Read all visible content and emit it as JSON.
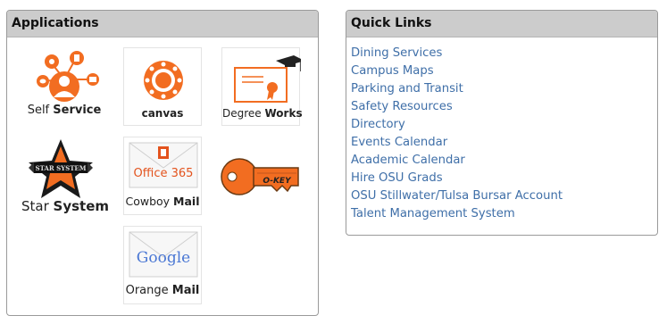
{
  "applications": {
    "title": "Applications",
    "tiles": {
      "self_service": {
        "label_a": "Self ",
        "label_b": "Service"
      },
      "canvas": {
        "label": "canvas"
      },
      "degree_works": {
        "label_a": "Degree ",
        "label_b": "Works"
      },
      "star_system": {
        "label_a": "Star ",
        "label_b": "System",
        "badge_text": "STAR SYSTEM"
      },
      "cowboy_mail": {
        "label_a": "Cowboy ",
        "label_b": "Mail",
        "logo_text": "Office 365"
      },
      "okey": {
        "label": "O-KEY"
      },
      "orange_mail": {
        "label_a": "Orange ",
        "label_b": "Mail",
        "logo_text": "Google"
      }
    }
  },
  "quick_links": {
    "title": "Quick Links",
    "items": [
      "Dining Services",
      "Campus Maps",
      "Parking and Transit",
      "Safety Resources",
      "Directory",
      "Events Calendar",
      "Academic Calendar",
      "Hire OSU Grads",
      "OSU Stillwater/Tulsa Bursar Account",
      "Talent Management System"
    ]
  },
  "colors": {
    "osu_orange": "#f26d21",
    "link_blue": "#3f6fa8",
    "header_gray": "#cccccc"
  }
}
